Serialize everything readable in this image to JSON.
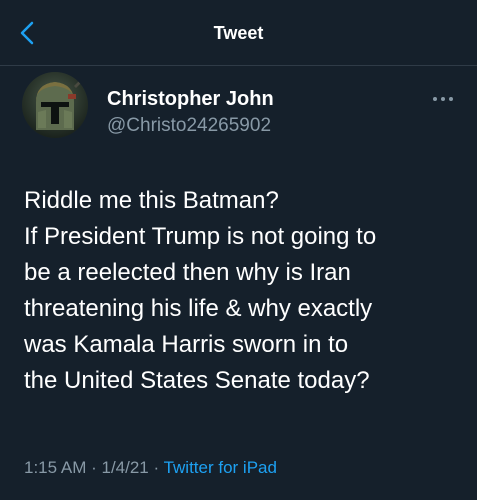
{
  "header": {
    "title": "Tweet",
    "back_icon": "chevron-left-icon",
    "accent_color": "#1da1f2"
  },
  "tweet": {
    "author": {
      "name": "Christopher John",
      "handle": "@Christo24265902",
      "avatar_icon": "helmet-avatar"
    },
    "more_icon": "more-dots-icon",
    "text_lines": [
      "Riddle me this Batman?",
      "If President Trump is not going to",
      "be a reelected then why is Iran",
      "threatening his life & why exactly",
      "was Kamala Harris sworn in to",
      "the United States Senate today?"
    ],
    "time": "1:15 AM",
    "date": "1/4/21",
    "separator": "·",
    "source": "Twitter for iPad"
  },
  "theme": {
    "background": "#15202b",
    "text": "#ffffff",
    "secondary_text": "#8899a6"
  }
}
